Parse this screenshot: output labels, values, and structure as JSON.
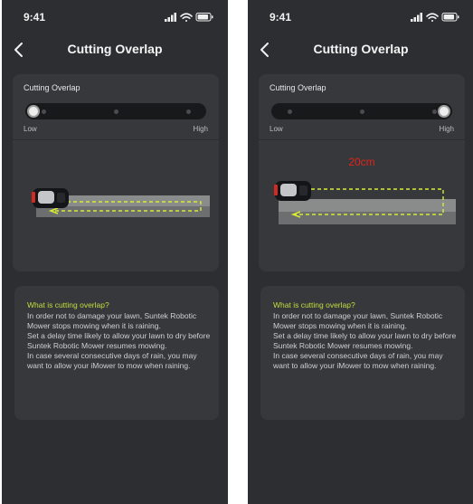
{
  "screens": [
    {
      "status_time": "9:41",
      "title": "Cutting Overlap",
      "card_label": "Cutting Overlap",
      "slider": {
        "low_label": "Low",
        "high_label": "High",
        "level": 0
      },
      "overlap_value": "",
      "info": {
        "title": "What is cutting overlap?",
        "paragraphs": [
          "In order not to damage your lawn, Suntek Robotic Mower stops mowing when it is raining.",
          "Set a delay time likely to allow your lawn to dry before Suntek Robotic Mower resumes mowing.",
          "In case several consecutive days of rain, you may want to allow your iMower to mow when raining."
        ]
      }
    },
    {
      "status_time": "9:41",
      "title": "Cutting Overlap",
      "card_label": "Cutting Overlap",
      "slider": {
        "low_label": "Low",
        "high_label": "High",
        "level": 1
      },
      "overlap_value": "20cm",
      "info": {
        "title": "What is cutting overlap?",
        "paragraphs": [
          "In order not to damage your lawn, Suntek Robotic Mower stops mowing when it is raining.",
          "Set a delay time likely to allow your lawn to dry before Suntek Robotic Mower resumes mowing.",
          "In case several consecutive days of rain, you may want to allow your iMower to mow when raining."
        ]
      }
    }
  ],
  "icons": {
    "back": "chevron-left-icon",
    "signal": "cellular-signal-icon",
    "wifi": "wifi-icon",
    "battery": "battery-icon",
    "mower": "robot-mower-icon"
  },
  "colors": {
    "background": "#2c2e31",
    "card": "#36383c",
    "accent": "#c4de3c",
    "overlap_value": "#e0241a",
    "path_dashes": "#d7ec34"
  }
}
